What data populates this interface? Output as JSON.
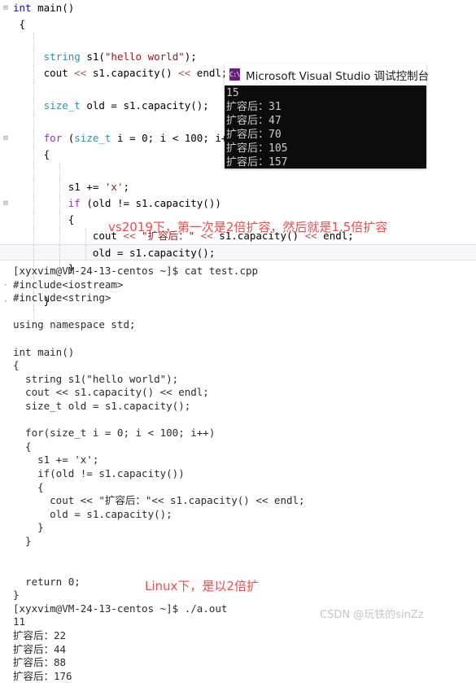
{
  "editor": {
    "name": "visual-studio-code-editor",
    "lines": [
      {
        "gutter": "⊟",
        "indents": [],
        "tokens": [
          {
            "t": "int ",
            "c": "kw-blue"
          },
          {
            "t": "main",
            "c": "plain"
          },
          {
            "t": "()",
            "c": "plain"
          }
        ]
      },
      {
        "gutter": "",
        "indents": [],
        "tokens": [
          {
            "t": " {",
            "c": "plain"
          }
        ]
      },
      {
        "gutter": "",
        "indents": [
          41
        ],
        "tokens": [
          {
            "t": "",
            "c": "plain"
          }
        ]
      },
      {
        "gutter": "",
        "indents": [
          41
        ],
        "tokens": [
          {
            "t": "     ",
            "c": "plain"
          },
          {
            "t": "string",
            "c": "kw-type"
          },
          {
            "t": " s1(",
            "c": "plain"
          },
          {
            "t": "\"hello world\"",
            "c": "str"
          },
          {
            "t": ");",
            "c": "plain"
          }
        ]
      },
      {
        "gutter": "",
        "indents": [
          41
        ],
        "tokens": [
          {
            "t": "     cout ",
            "c": "plain"
          },
          {
            "t": "<<",
            "c": "op-red"
          },
          {
            "t": " s1.capacity() ",
            "c": "plain"
          },
          {
            "t": "<<",
            "c": "op-red"
          },
          {
            "t": " endl;",
            "c": "plain"
          }
        ]
      },
      {
        "gutter": "",
        "indents": [
          41
        ],
        "tokens": [
          {
            "t": "",
            "c": "plain"
          }
        ]
      },
      {
        "gutter": "",
        "indents": [
          41
        ],
        "tokens": [
          {
            "t": "     ",
            "c": "plain"
          },
          {
            "t": "size_t",
            "c": "kw-type"
          },
          {
            "t": " old = s1.capacity();",
            "c": "plain"
          }
        ]
      },
      {
        "gutter": "",
        "indents": [
          41
        ],
        "tokens": [
          {
            "t": "",
            "c": "plain"
          }
        ]
      },
      {
        "gutter": "⊟",
        "indents": [
          41
        ],
        "tokens": [
          {
            "t": "     ",
            "c": "plain"
          },
          {
            "t": "for",
            "c": "kw-ctrl"
          },
          {
            "t": " (",
            "c": "plain"
          },
          {
            "t": "size_t",
            "c": "kw-type"
          },
          {
            "t": " i = 0; i < 100; i++)",
            "c": "plain"
          }
        ]
      },
      {
        "gutter": "",
        "indents": [
          41
        ],
        "tokens": [
          {
            "t": "     {",
            "c": "plain"
          }
        ]
      },
      {
        "gutter": "",
        "indents": [
          41,
          73
        ],
        "tokens": [
          {
            "t": "",
            "c": "plain"
          }
        ]
      },
      {
        "gutter": "",
        "indents": [
          41,
          73
        ],
        "tokens": [
          {
            "t": "         s1 += ",
            "c": "plain"
          },
          {
            "t": "'x'",
            "c": "str"
          },
          {
            "t": ";",
            "c": "plain"
          }
        ]
      },
      {
        "gutter": "⊟",
        "indents": [
          41,
          73
        ],
        "tokens": [
          {
            "t": "         ",
            "c": "plain"
          },
          {
            "t": "if",
            "c": "kw-ctrl"
          },
          {
            "t": " (old != s1.capacity())",
            "c": "plain"
          }
        ]
      },
      {
        "gutter": "",
        "indents": [
          41,
          73
        ],
        "tokens": [
          {
            "t": "         {",
            "c": "plain"
          }
        ]
      },
      {
        "gutter": "",
        "indents": [
          41,
          73,
          105
        ],
        "tokens": [
          {
            "t": "             cout ",
            "c": "plain"
          },
          {
            "t": "<<",
            "c": "op-red"
          },
          {
            "t": " \"扩容后：\"",
            "c": "str"
          },
          {
            "t": " ",
            "c": "plain"
          },
          {
            "t": "<<",
            "c": "op-red"
          },
          {
            "t": " s1.capacity() ",
            "c": "plain"
          },
          {
            "t": "<<",
            "c": "op-red"
          },
          {
            "t": " endl;",
            "c": "plain"
          }
        ]
      },
      {
        "gutter": "",
        "indents": [
          41,
          73,
          105
        ],
        "cur": true,
        "tokens": [
          {
            "t": "             old = s1.capacity();",
            "c": "plain"
          }
        ]
      },
      {
        "gutter": "",
        "indents": [
          41,
          73
        ],
        "tokens": [
          {
            "t": "         }",
            "c": "plain"
          }
        ]
      },
      {
        "gutter": "-",
        "indents": [
          41
        ],
        "tokens": [
          {
            "t": "",
            "c": "plain"
          }
        ]
      },
      {
        "gutter": "-",
        "indents": [
          41
        ],
        "tokens": [
          {
            "t": "     }",
            "c": "plain"
          }
        ]
      },
      {
        "gutter": "",
        "indents": [
          41
        ],
        "tokens": [
          {
            "t": "",
            "c": "plain"
          }
        ]
      }
    ]
  },
  "console": {
    "app_icon": "console-window-icon",
    "icon_glyph": "C:\\",
    "title": "Microsoft Visual Studio 调试控制台",
    "title_color": "#1b1b1b",
    "icon_color": "#68217a",
    "background": "#0c0c0c",
    "text_color": "#cccccc",
    "output_lines": [
      "15",
      "扩容后：31",
      "扩容后：47",
      "扩容后：70",
      "扩容后：105",
      "扩容后：157"
    ]
  },
  "annotations": {
    "color": "#f54b4b",
    "vs_note": "vs2019下，第一次是2倍扩容，然后就是1.5倍扩容",
    "linux_note": "Linux下，是以2倍扩"
  },
  "terminal": {
    "prompt": "[xyxvim@VM-24-13-centos ~]$",
    "lines": [
      "[xyxvim@VM-24-13-centos ~]$ cat test.cpp",
      "#include<iostream>",
      "#include<string>",
      "",
      "using namespace std;",
      "",
      "int main()",
      "{",
      "  string s1(\"hello world\");",
      "  cout << s1.capacity() << endl;",
      "  size_t old = s1.capacity();",
      "",
      "  for(size_t i = 0; i < 100; i++)",
      "  {",
      "    s1 += 'x';",
      "    if(old != s1.capacity())",
      "    {",
      "      cout << \"扩容后：\"<< s1.capacity() << endl;",
      "      old = s1.capacity();",
      "    }",
      "  }",
      "",
      "",
      "  return 0;",
      "}",
      "[xyxvim@VM-24-13-centos ~]$ ./a.out",
      "11",
      "扩容后：22",
      "扩容后：44",
      "扩容后：88",
      "扩容后：176"
    ]
  },
  "watermark": {
    "text": "CSDN @玩铁的sinZz",
    "color": "#c6c6c6"
  }
}
